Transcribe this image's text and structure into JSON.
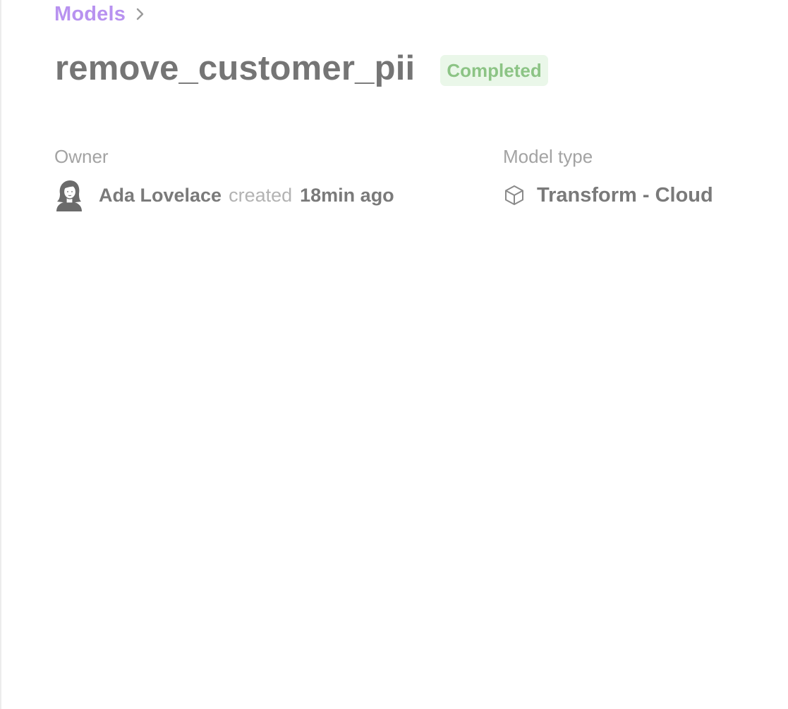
{
  "breadcrumb": {
    "items": [
      {
        "label": "Models"
      }
    ],
    "separator_icon": "chevron-right-icon",
    "link_color": "#b892f0"
  },
  "header": {
    "title": "remove_customer_pii",
    "status": {
      "label": "Completed",
      "text_color": "#8cc485",
      "background_color": "#eaf7e9"
    }
  },
  "meta": {
    "owner": {
      "label": "Owner",
      "avatar_icon": "user-avatar-icon",
      "name": "Ada Lovelace",
      "created_word": "created",
      "created_time": "18min ago"
    },
    "model_type": {
      "label": "Model type",
      "icon": "cube-icon",
      "value": "Transform - Cloud"
    }
  }
}
